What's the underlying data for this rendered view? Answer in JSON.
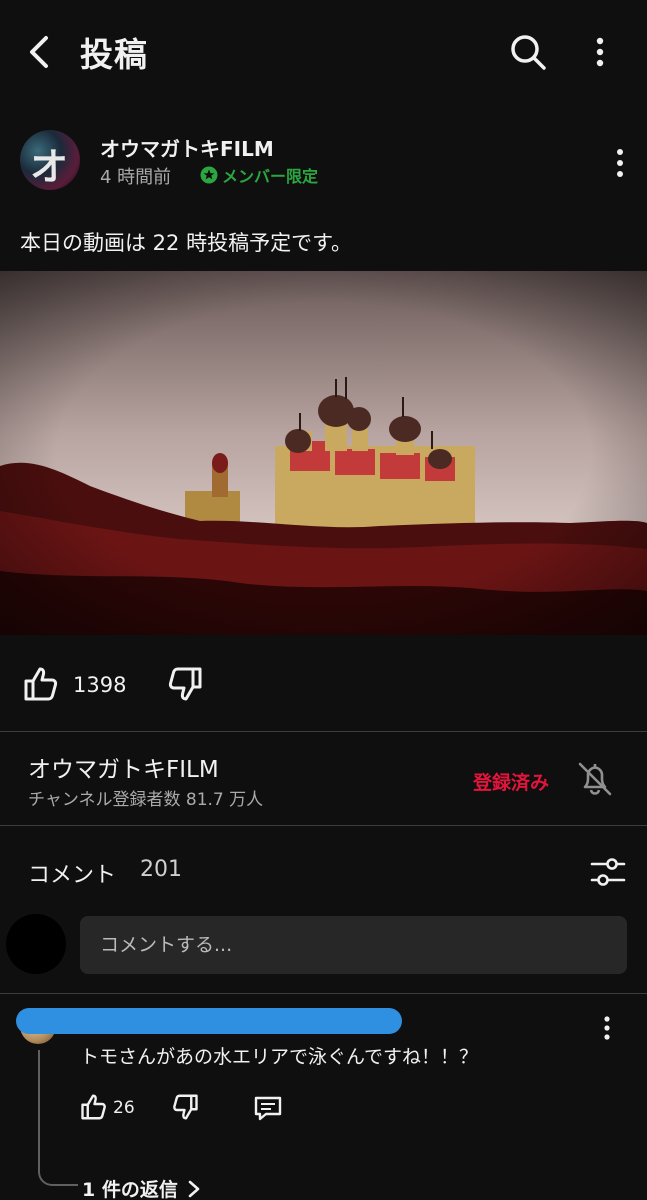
{
  "header": {
    "title": "投稿",
    "back_icon": "chevron-left-icon",
    "search_icon": "search-icon",
    "more_icon": "more-vert-icon"
  },
  "post": {
    "channel_name": "オウマガトキFILM",
    "time": "4 時間前",
    "member_badge": "メンバー限定",
    "text": "本日の動画は 22 時投稿予定です。",
    "image_alt": "教会の写真",
    "likes": "1398"
  },
  "channel": {
    "name": "オウマガトキFILM",
    "subscribers": "チャンネル登録者数 81.7 万人",
    "subscribed_label": "登録済み"
  },
  "comments": {
    "label": "コメント",
    "count": "201",
    "input_placeholder": "コメントする...",
    "items": [
      {
        "text": "トモさんがあの水エリアで泳ぐんですね！！？",
        "likes": "26",
        "replies_label": "1 件の返信"
      }
    ]
  },
  "colors": {
    "background": "#0f0f0f",
    "member_green": "#2ba640",
    "subscribed_red": "#e1143c",
    "input_bg": "#272727",
    "redaction_blue": "#2f8fe0"
  }
}
